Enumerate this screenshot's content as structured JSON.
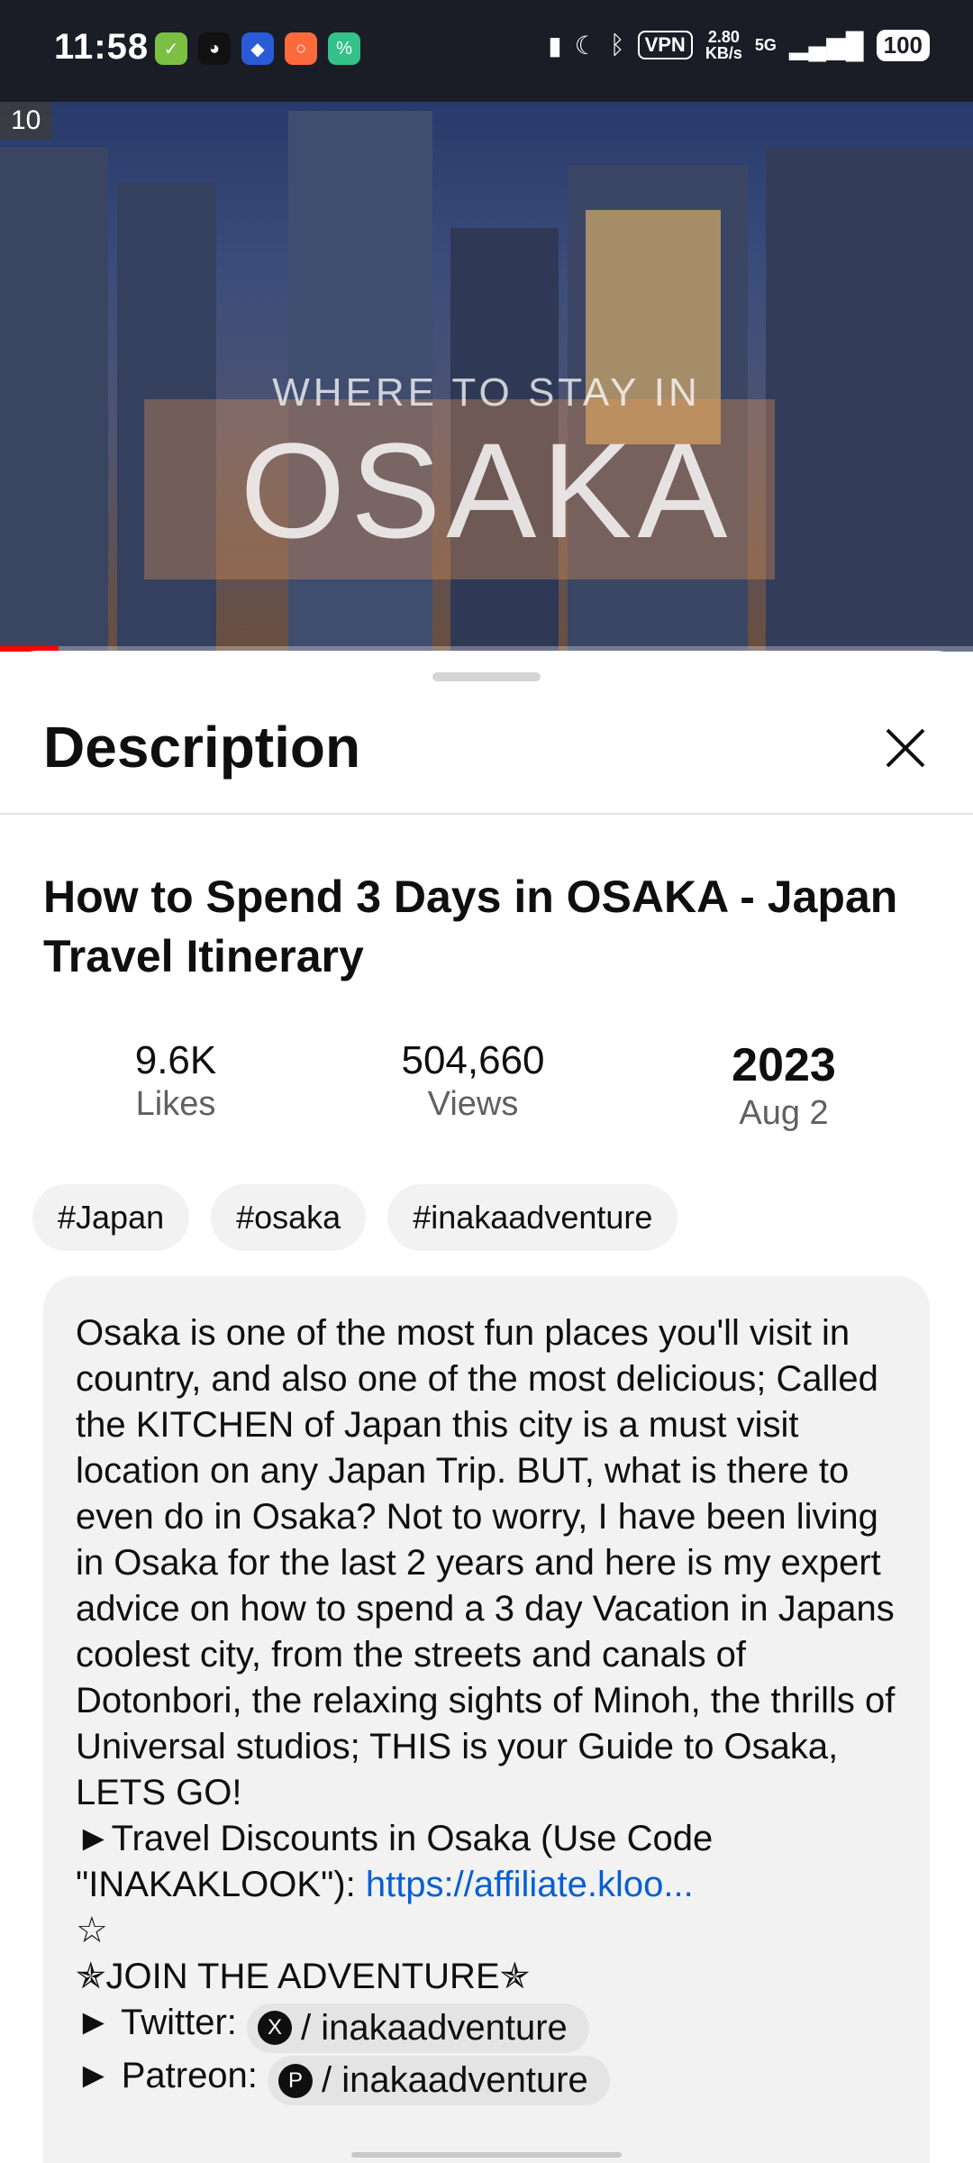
{
  "status_bar": {
    "time": "11:58",
    "vpn": "VPN",
    "speed_value": "2.80",
    "speed_unit": "KB/s",
    "network": "5G",
    "battery": "100"
  },
  "video": {
    "subtitle": "WHERE TO STAY IN",
    "title": "OSAKA",
    "progress_fraction": 0.06,
    "badge": "10"
  },
  "sheet": {
    "title": "Description",
    "video_title": "How to Spend 3 Days in OSAKA - Japan Travel Itinerary",
    "stats": [
      {
        "value": "9.6K",
        "label": "Likes"
      },
      {
        "value": "504,660",
        "label": "Views"
      },
      {
        "value": "2023",
        "label": "Aug 2"
      }
    ],
    "tags": [
      "#Japan",
      "#osaka",
      "#inakaadventure"
    ],
    "description": {
      "paragraph": "Osaka is one of the most fun places you'll visit in country, and also one of the most delicious; Called the KITCHEN of Japan this city is a must visit location on any Japan Trip. BUT, what is there to even do in Osaka? Not to worry, I have been living in Osaka for the last 2 years and here is my expert advice on how to spend a 3 day Vacation in Japans coolest city, from the streets and canals of Dotonbori, the relaxing sights of Minoh, the thrills of Universal studios; THIS is your Guide to Osaka, LETS GO!",
      "discount_prefix": "►Travel Discounts in Osaka (Use Code \"INAKAKLOOK\"): ",
      "discount_link": "https://affiliate.kloo...",
      "star_line": "☆",
      "join_line": "✯JOIN THE ADVENTURE✯",
      "twitter_label": "► Twitter: ",
      "twitter_handle": "/ inakaadventure",
      "patreon_label": "► Patreon: ",
      "patreon_handle": "/ inakaadventure"
    }
  }
}
